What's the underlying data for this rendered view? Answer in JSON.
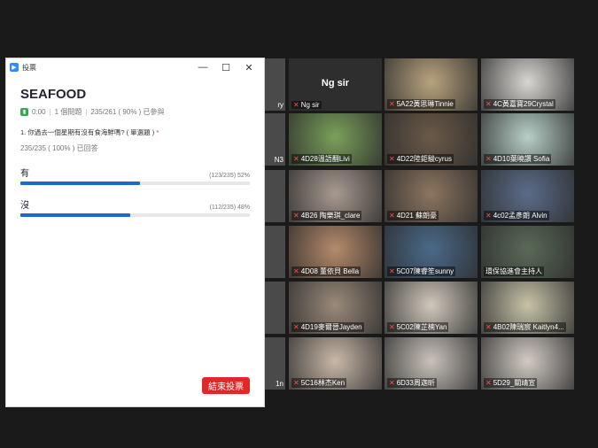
{
  "window": {
    "title": "投票",
    "minimize": "—",
    "maximize": "☐",
    "close": "✕"
  },
  "poll": {
    "title": "SEAFOOD",
    "timer": "0:00",
    "sep1": "|",
    "questions_count": "1 個問題",
    "sep2": "|",
    "participation": "235/261 ( 90% ) 已參與",
    "question": "1. 你過去一個星期有沒有食海鮮嗎? ( 單選題 )",
    "required_mark": "*",
    "answered": "235/235 ( 100% ) 已回答",
    "options": [
      {
        "label": "有",
        "stat": "(123/235) 52%",
        "fraction": 0.52
      },
      {
        "label": "沒",
        "stat": "(112/235) 48%",
        "fraction": 0.48
      }
    ],
    "end_button": "結束投票"
  },
  "participants": [
    {
      "name": "",
      "muted": false,
      "color": "#8a8a7a"
    },
    {
      "name": "",
      "muted": false,
      "color": "#6a7a8a"
    },
    {
      "name": "5A22黃思琳Tinnie",
      "muted": true,
      "color": "#b9a37d"
    },
    {
      "name": "4C黃嘉寶29Crystal",
      "muted": true,
      "color": "#d8d6d2"
    },
    {
      "name": "4D28溫語翻Livi",
      "muted": true,
      "color": "#7aa05a"
    },
    {
      "name": "4D22陸鉅駿cyrus",
      "muted": true,
      "color": "#6b5a48"
    },
    {
      "name": "4D10葉曉讚 Sofia",
      "muted": true,
      "color": "#b7cfc6"
    },
    {
      "name": "4B26 陶樂琪_clare",
      "muted": true,
      "color": "#a89a90"
    },
    {
      "name": "4D21 蘇朗豪",
      "muted": true,
      "color": "#8c7560"
    },
    {
      "name": "4c02孟彥朗 Alvin",
      "muted": true,
      "color": "#5b6c8a"
    },
    {
      "name": "4D08 董依貝 Bella",
      "muted": true,
      "color": "#b58a6a"
    },
    {
      "name": "5C07陳睿笙sunny",
      "muted": true,
      "color": "#4a6a8a"
    },
    {
      "name": "環保協進會主持人",
      "muted": false,
      "color": "#5a6a58"
    },
    {
      "name": "4D19麥爾晉Jayden",
      "muted": true,
      "color": "#9a8a7a"
    },
    {
      "name": "5C02陳芷楠Yan",
      "muted": true,
      "color": "#d0c8bc"
    },
    {
      "name": "4B02陳瑞宸 Kaitlyn4...",
      "muted": true,
      "color": "#c7c3a8"
    },
    {
      "name": "5C16林杰Ken",
      "muted": true,
      "color": "#c9b8a8"
    },
    {
      "name": "6D33周迦昕",
      "muted": true,
      "color": "#c9c2bb"
    },
    {
      "name": "5D29_關靖宣",
      "muted": true,
      "color": "#d2cbc4"
    }
  ],
  "ng_sir": {
    "label": "Ng sir",
    "name": "Ng sir",
    "muted": true
  },
  "edge_labels": [
    "ry",
    "N3",
    "",
    "",
    "",
    "1n"
  ]
}
